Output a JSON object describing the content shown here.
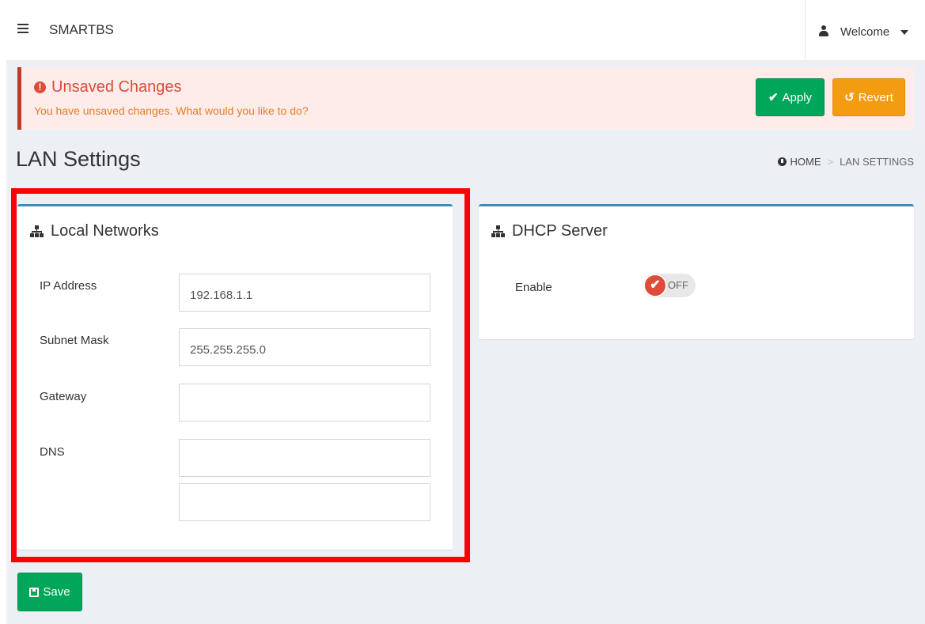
{
  "app": {
    "brand": "SMARTBS",
    "user_menu_label": "Welcome"
  },
  "alert": {
    "title": "Unsaved Changes",
    "message": "You have unsaved changes. What would you like to do?",
    "apply_label": "Apply",
    "revert_label": "Revert"
  },
  "page": {
    "title": "LAN Settings",
    "breadcrumb": {
      "home": "HOME",
      "current": "LAN SETTINGS"
    }
  },
  "local_networks": {
    "title": "Local Networks",
    "fields": {
      "ip_address": {
        "label": "IP Address",
        "value": "192.168.1.1"
      },
      "subnet_mask": {
        "label": "Subnet Mask",
        "value": "255.255.255.0"
      },
      "gateway": {
        "label": "Gateway",
        "value": ""
      },
      "dns": {
        "label": "DNS",
        "value_1": "",
        "value_2": ""
      }
    }
  },
  "dhcp_server": {
    "title": "DHCP Server",
    "enable_label": "Enable",
    "toggle_state": "OFF"
  },
  "actions": {
    "save_label": "Save"
  },
  "colors": {
    "accent_blue": "#3c8dbc",
    "success_green": "#00a65a",
    "warning_orange": "#f39c12",
    "danger_red": "#dd4b39",
    "highlight_red": "#ff0000"
  }
}
